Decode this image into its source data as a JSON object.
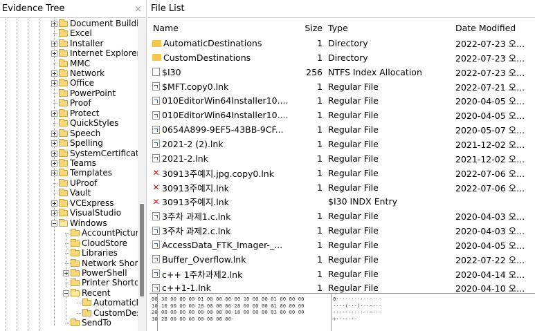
{
  "evidence_tree": {
    "title": "Evidence Tree",
    "close_glyph": "×",
    "nodes": [
      {
        "label": "Document Buildi",
        "expander": "plus",
        "indent": 0
      },
      {
        "label": "Excel",
        "expander": "none",
        "indent": 0
      },
      {
        "label": "Installer",
        "expander": "plus",
        "indent": 0
      },
      {
        "label": "Internet Explorer",
        "expander": "plus",
        "indent": 0
      },
      {
        "label": "MMC",
        "expander": "none",
        "indent": 0
      },
      {
        "label": "Network",
        "expander": "plus",
        "indent": 0
      },
      {
        "label": "Office",
        "expander": "plus",
        "indent": 0
      },
      {
        "label": "PowerPoint",
        "expander": "none",
        "indent": 0
      },
      {
        "label": "Proof",
        "expander": "none",
        "indent": 0
      },
      {
        "label": "Protect",
        "expander": "plus",
        "indent": 0
      },
      {
        "label": "QuickStyles",
        "expander": "none",
        "indent": 0
      },
      {
        "label": "Speech",
        "expander": "plus",
        "indent": 0
      },
      {
        "label": "Spelling",
        "expander": "plus",
        "indent": 0
      },
      {
        "label": "SystemCertificat",
        "expander": "plus",
        "indent": 0
      },
      {
        "label": "Teams",
        "expander": "plus",
        "indent": 0
      },
      {
        "label": "Templates",
        "expander": "plus",
        "indent": 0
      },
      {
        "label": "UProof",
        "expander": "none",
        "indent": 0
      },
      {
        "label": "Vault",
        "expander": "none",
        "indent": 0
      },
      {
        "label": "VCExpress",
        "expander": "plus",
        "indent": 0
      },
      {
        "label": "VisualStudio",
        "expander": "plus",
        "indent": 0
      },
      {
        "label": "Windows",
        "expander": "minus",
        "indent": 0
      },
      {
        "label": "AccountPictur",
        "expander": "none",
        "indent": 1
      },
      {
        "label": "CloudStore",
        "expander": "none",
        "indent": 1
      },
      {
        "label": "Libraries",
        "expander": "none",
        "indent": 1
      },
      {
        "label": "Network Shor",
        "expander": "none",
        "indent": 1
      },
      {
        "label": "PowerShell",
        "expander": "plus",
        "indent": 1
      },
      {
        "label": "Printer Shortc",
        "expander": "none",
        "indent": 1
      },
      {
        "label": "Recent",
        "expander": "minus",
        "indent": 1
      },
      {
        "label": "AutomaticD",
        "expander": "none",
        "indent": 2
      },
      {
        "label": "CustomDes",
        "expander": "none",
        "indent": 2
      },
      {
        "label": "SendTo",
        "expander": "none",
        "indent": 1
      }
    ]
  },
  "file_list": {
    "title": "File List",
    "columns": {
      "name": "Name",
      "size": "Size",
      "type": "Type",
      "date": "Date Modified"
    },
    "rows": [
      {
        "icon": "folder-icon",
        "name": "AutomaticDestinations",
        "size": "1",
        "type": "Directory",
        "date": "2022-07-23 오..."
      },
      {
        "icon": "folder-icon",
        "name": "CustomDestinations",
        "size": "1",
        "type": "Directory",
        "date": "2022-07-23 오..."
      },
      {
        "icon": "file-icon",
        "name": "$I30",
        "size": "256",
        "type": "NTFS Index Allocation",
        "date": "2022-07-23 오..."
      },
      {
        "icon": "shortcut-icon",
        "name": "$MFT.copy0.lnk",
        "size": "1",
        "type": "Regular File",
        "date": "2022-07-21 오..."
      },
      {
        "icon": "shortcut-icon",
        "name": "010EditorWin64Installer10....",
        "size": "1",
        "type": "Regular File",
        "date": "2020-04-05 오..."
      },
      {
        "icon": "shortcut-icon",
        "name": "010EditorWin64Installer10....",
        "size": "1",
        "type": "Regular File",
        "date": "2020-04-05 오..."
      },
      {
        "icon": "shortcut-icon",
        "name": "0654A899-9EF5-43BB-9CF...",
        "size": "1",
        "type": "Regular File",
        "date": "2020-05-07 오..."
      },
      {
        "icon": "shortcut-icon",
        "name": "2021-2 (2).lnk",
        "size": "1",
        "type": "Regular File",
        "date": "2021-12-02 오..."
      },
      {
        "icon": "shortcut-icon",
        "name": "2021-2.lnk",
        "size": "1",
        "type": "Regular File",
        "date": "2021-12-02 오..."
      },
      {
        "icon": "deleted-file-icon",
        "name": "30913주예지.jpg.copy0.lnk",
        "size": "1",
        "type": "Regular File",
        "date": "2022-07-06 오..."
      },
      {
        "icon": "deleted-file-icon",
        "name": "30913주예지.lnk",
        "size": "1",
        "type": "Regular File",
        "date": "2022-07-06 오..."
      },
      {
        "icon": "deleted-file-icon",
        "name": "30913주예지.lnk",
        "size": "",
        "type": "$I30 INDX Entry",
        "date": ""
      },
      {
        "icon": "shortcut-icon",
        "name": "3주차 과제1.c.lnk",
        "size": "1",
        "type": "Regular File",
        "date": "2020-04-03 오..."
      },
      {
        "icon": "shortcut-icon",
        "name": "3주차 과제2.c.lnk",
        "size": "1",
        "type": "Regular File",
        "date": "2020-04-03 오..."
      },
      {
        "icon": "shortcut-icon",
        "name": "AccessData_FTK_Imager-_...",
        "size": "1",
        "type": "Regular File",
        "date": "2020-04-05 오..."
      },
      {
        "icon": "shortcut-icon",
        "name": "Buffer_Overflow.lnk",
        "size": "1",
        "type": "Regular File",
        "date": "2022-07-22 오..."
      },
      {
        "icon": "shortcut-icon",
        "name": "c++ 1주차과제2.lnk",
        "size": "1",
        "type": "Regular File",
        "date": "2020-04-14 오..."
      },
      {
        "icon": "shortcut-icon",
        "name": "c++1-1.lnk",
        "size": "1",
        "type": "Regular File",
        "date": "2020-04-10 오..."
      }
    ]
  },
  "hex_view": {
    "lines": [
      {
        "offset": "00",
        "bytes": "30 00 00 00 01 00 00 00-00 10 00 00 01 00 00 00",
        "ascii": "0···············"
      },
      {
        "offset": "10",
        "bytes": "10 00 00 00 28 00 00 00-28 00 00 00 01 00 00 00",
        "ascii": "····(···(·······"
      },
      {
        "offset": "20",
        "bytes": "00 00 00 00 00 00 00 00-18 00 00 00 03 00 00 00",
        "ascii": "················"
      },
      {
        "offset": "30",
        "bytes": "2B 00 00 00 00 00 00 00-",
        "ascii": "+·······"
      }
    ]
  }
}
